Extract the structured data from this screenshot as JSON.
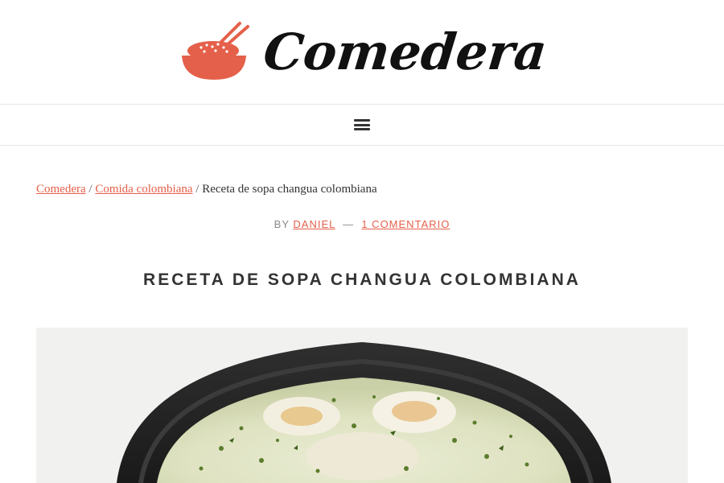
{
  "site": {
    "name": "Comedera"
  },
  "breadcrumb": {
    "home": "Comedera",
    "category": "Comida colombiana",
    "current": "Receta de sopa changua colombiana",
    "separator": "/"
  },
  "meta": {
    "by_label": "BY",
    "author": "DANIEL",
    "dash": "—",
    "comments": "1 COMENTARIO"
  },
  "article": {
    "title": "RECETA DE SOPA CHANGUA COLOMBIANA"
  },
  "colors": {
    "accent": "#e5604a",
    "text": "#333333",
    "muted": "#888888"
  },
  "icons": {
    "logo": "rice-bowl-chopsticks-icon",
    "menu": "hamburger-menu-icon"
  }
}
